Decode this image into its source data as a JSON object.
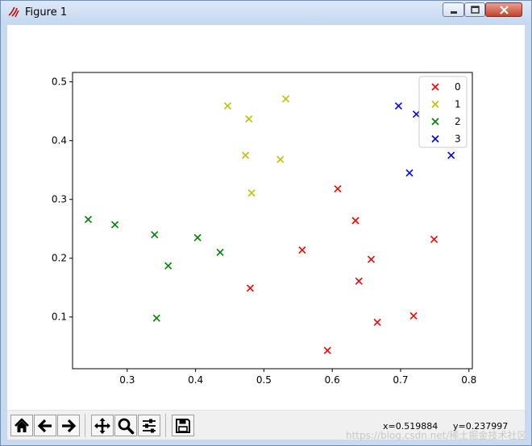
{
  "window": {
    "title": "Figure 1"
  },
  "chart_data": {
    "type": "scatter",
    "marker": "x",
    "xlim": [
      0.22,
      0.805
    ],
    "ylim": [
      0.012,
      0.516
    ],
    "xticks": [
      0.3,
      0.4,
      0.5,
      0.6,
      0.7,
      0.8
    ],
    "yticks": [
      0.1,
      0.2,
      0.3,
      0.4,
      0.5
    ],
    "xtick_labels": [
      "0.3",
      "0.4",
      "0.5",
      "0.6",
      "0.7",
      "0.8"
    ],
    "ytick_labels": [
      "0.1",
      "0.2",
      "0.3",
      "0.4",
      "0.5"
    ],
    "grid": false,
    "legend_position": "top-right",
    "series": [
      {
        "name": "0",
        "color": "#ff0000",
        "points": [
          [
            0.608,
            0.318
          ],
          [
            0.634,
            0.264
          ],
          [
            0.556,
            0.214
          ],
          [
            0.657,
            0.198
          ],
          [
            0.639,
            0.161
          ],
          [
            0.48,
            0.149
          ],
          [
            0.749,
            0.232
          ],
          [
            0.719,
            0.102
          ],
          [
            0.666,
            0.091
          ],
          [
            0.593,
            0.043
          ]
        ]
      },
      {
        "name": "1",
        "color": "#bfbf00",
        "points": [
          [
            0.447,
            0.459
          ],
          [
            0.532,
            0.471
          ],
          [
            0.478,
            0.437
          ],
          [
            0.473,
            0.375
          ],
          [
            0.524,
            0.368
          ],
          [
            0.482,
            0.311
          ]
        ]
      },
      {
        "name": "2",
        "color": "#008000",
        "points": [
          [
            0.243,
            0.266
          ],
          [
            0.282,
            0.257
          ],
          [
            0.34,
            0.24
          ],
          [
            0.403,
            0.235
          ],
          [
            0.36,
            0.187
          ],
          [
            0.436,
            0.21
          ],
          [
            0.343,
            0.098
          ]
        ]
      },
      {
        "name": "3",
        "color": "#0000ff",
        "points": [
          [
            0.697,
            0.459
          ],
          [
            0.723,
            0.445
          ],
          [
            0.774,
            0.375
          ],
          [
            0.713,
            0.345
          ]
        ]
      }
    ]
  },
  "toolbar": {
    "buttons": [
      {
        "name": "home-button",
        "icon": "home-icon"
      },
      {
        "name": "back-button",
        "icon": "arrow-left-icon"
      },
      {
        "name": "forward-button",
        "icon": "arrow-right-icon"
      },
      {
        "name": "pan-button",
        "icon": "move-icon"
      },
      {
        "name": "zoom-button",
        "icon": "magnifier-icon"
      },
      {
        "name": "configure-subplots-button",
        "icon": "sliders-icon"
      },
      {
        "name": "save-button",
        "icon": "floppy-disk-icon"
      }
    ],
    "x_readout": "x=0.519884",
    "y_readout": "y=0.237997"
  },
  "overlay": {
    "watermark": "https://blog.csdn.net/稀土掘金技术社区"
  }
}
